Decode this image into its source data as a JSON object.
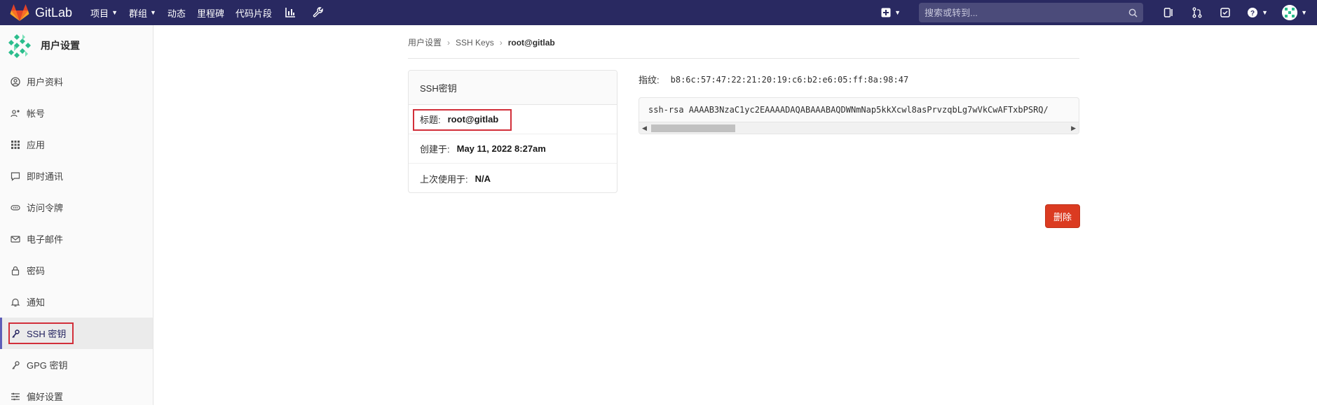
{
  "navbar": {
    "brand": "GitLab",
    "links": [
      {
        "label": "项目",
        "dropdown": true
      },
      {
        "label": "群组",
        "dropdown": true
      },
      {
        "label": "动态",
        "dropdown": false
      },
      {
        "label": "里程碑",
        "dropdown": false
      },
      {
        "label": "代码片段",
        "dropdown": false
      }
    ],
    "search_placeholder": "搜索或转到...",
    "colors": {
      "background": "#292961",
      "search_bg": "#4b4b7a"
    }
  },
  "sidebar": {
    "title": "用户设置",
    "items": [
      {
        "label": "用户资料",
        "icon": "profile-icon"
      },
      {
        "label": "帐号",
        "icon": "account-icon"
      },
      {
        "label": "应用",
        "icon": "applications-icon"
      },
      {
        "label": "即时通讯",
        "icon": "chat-icon"
      },
      {
        "label": "访问令牌",
        "icon": "token-icon"
      },
      {
        "label": "电子邮件",
        "icon": "mail-icon"
      },
      {
        "label": "密码",
        "icon": "lock-icon"
      },
      {
        "label": "通知",
        "icon": "bell-icon"
      },
      {
        "label": "SSH 密钥",
        "icon": "key-icon",
        "active": true
      },
      {
        "label": "GPG 密钥",
        "icon": "key-icon"
      },
      {
        "label": "偏好设置",
        "icon": "preferences-icon"
      }
    ]
  },
  "breadcrumb": {
    "items": [
      "用户设置",
      "SSH Keys",
      "root@gitlab"
    ]
  },
  "key_card": {
    "header": "SSH密钥",
    "title_label": "标题:",
    "title_value": "root@gitlab",
    "created_label": "创建于:",
    "created_value": "May 11, 2022 8:27am",
    "last_used_label": "上次使用于:",
    "last_used_value": "N/A"
  },
  "fingerprint": {
    "label": "指纹:",
    "value": "b8:6c:57:47:22:21:20:19:c6:b2:e6:05:ff:8a:98:47"
  },
  "public_key": "ssh-rsa AAAAB3NzaC1yc2EAAAADAQABAAABAQDWNmNap5kkXcwl8asPrvzqbLg7wVkCwAFTxbPSRQ/",
  "delete_button": "删除",
  "colors": {
    "accent": "#5e5eb8",
    "danger": "#db3b21",
    "highlight_box": "#d22f3a"
  }
}
